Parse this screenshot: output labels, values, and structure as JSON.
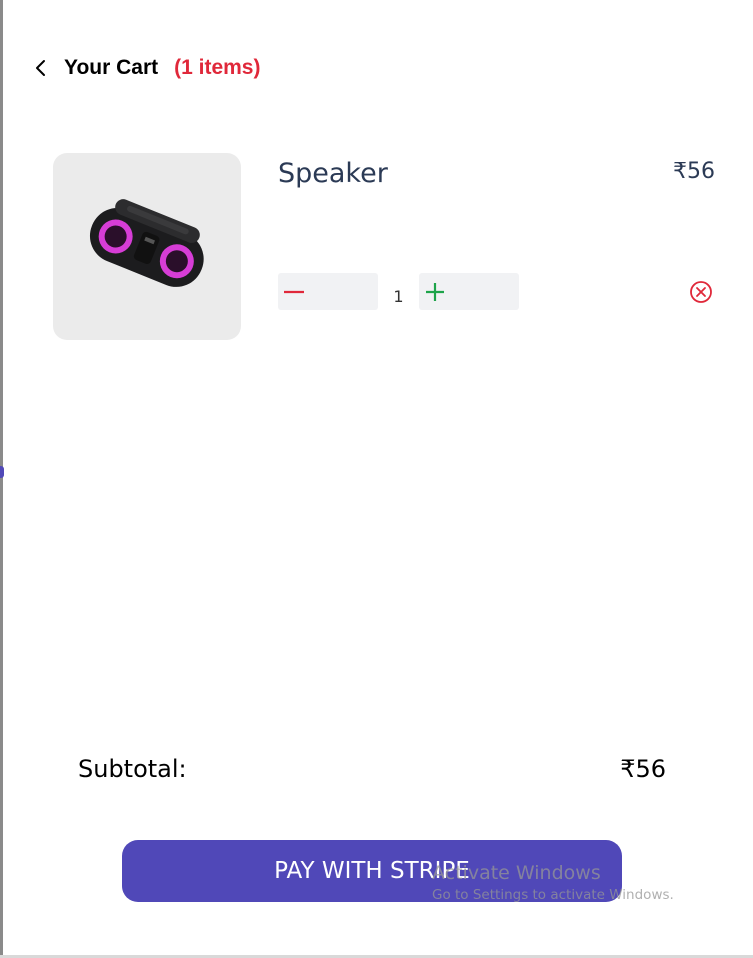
{
  "header": {
    "title": "Your Cart",
    "item_count": "(1 items)"
  },
  "cart": {
    "items": [
      {
        "name": "Speaker",
        "price": "₹56",
        "quantity": "1",
        "image_icon": "speaker-product-image"
      }
    ]
  },
  "summary": {
    "subtotal_label": "Subtotal:",
    "subtotal_value": "₹56"
  },
  "checkout": {
    "pay_label": "PAY WITH STRIPE"
  },
  "watermark": {
    "title": "Activate Windows",
    "subtitle": "Go to Settings to activate Windows."
  },
  "colors": {
    "accent": "#5048b8",
    "count": "#e0283a",
    "minus": "#e0283a",
    "plus": "#1ea44a",
    "text": "#2b3a55"
  }
}
